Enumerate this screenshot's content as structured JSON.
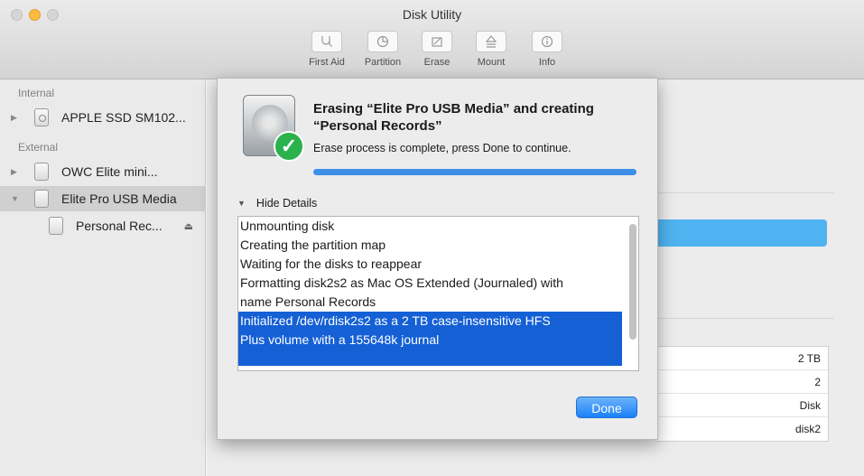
{
  "window": {
    "title": "Disk Utility"
  },
  "toolbar": {
    "items": [
      {
        "label": "First Aid",
        "icon": "stethoscope-icon"
      },
      {
        "label": "Partition",
        "icon": "pie-icon"
      },
      {
        "label": "Erase",
        "icon": "eraser-icon"
      },
      {
        "label": "Mount",
        "icon": "mount-icon"
      },
      {
        "label": "Info",
        "icon": "info-icon"
      }
    ]
  },
  "sidebar": {
    "internal_header": "Internal",
    "external_header": "External",
    "items": [
      {
        "label": "APPLE SSD SM102..."
      },
      {
        "label": "OWC Elite mini..."
      },
      {
        "label": "Elite Pro USB Media"
      },
      {
        "label": "Personal Rec..."
      }
    ]
  },
  "info_table": {
    "values": [
      "2 TB",
      "2",
      "Disk",
      "disk2"
    ]
  },
  "sheet": {
    "title": "Erasing “Elite Pro USB Media” and creating “Personal Records”",
    "subtitle": "Erase process is complete, press Done to continue.",
    "progress": 1.0,
    "details_toggle": "Hide Details",
    "log": [
      "Unmounting disk",
      "Creating the partition map",
      "Waiting for the disks to reappear",
      "Formatting disk2s2 as Mac OS Extended (Journaled) with",
      "name Personal Records",
      "Initialized /dev/rdisk2s2 as a 2 TB case-insensitive HFS",
      "Plus volume with a 155648k journal"
    ],
    "done_label": "Done"
  },
  "colors": {
    "accent": "#1560d5",
    "progress": "#3e8fe8",
    "success": "#2bb24c"
  }
}
